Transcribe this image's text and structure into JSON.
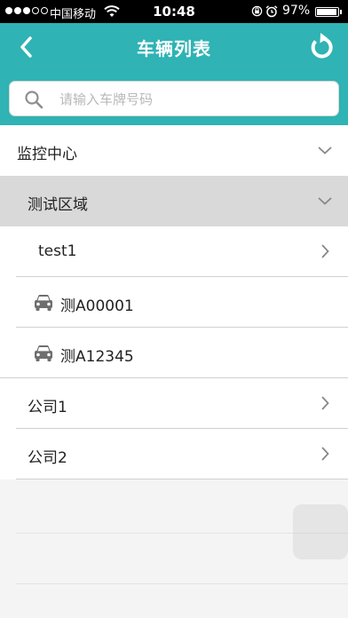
{
  "status_bar": {
    "carrier": "中国移动",
    "time": "10:48",
    "battery": "97%",
    "battery_level": 0.97,
    "signal_bars_filled": 3,
    "signal_bars_total": 5
  },
  "nav": {
    "title": "车辆列表",
    "back_icon": "chevron-left-icon",
    "refresh_icon": "refresh-icon"
  },
  "search": {
    "placeholder": "请输入车牌号码",
    "value": "",
    "icon": "search-icon"
  },
  "tree": {
    "root": {
      "label": "监控中心",
      "icon": "chevron-down-icon"
    },
    "region": {
      "label": "测试区域",
      "icon": "chevron-down-icon"
    },
    "group_test1": {
      "label": "test1",
      "icon": "chevron-right-icon"
    },
    "vehicles": [
      {
        "label": "测A00001",
        "icon": "car-icon"
      },
      {
        "label": "测A12345",
        "icon": "car-icon"
      }
    ],
    "companies": [
      {
        "label": "公司1",
        "icon": "chevron-right-icon"
      },
      {
        "label": "公司2",
        "icon": "chevron-right-icon"
      }
    ]
  },
  "colors": {
    "accent": "#2fb3b4",
    "selected_row": "#d9d9d9",
    "background": "#f4f4f4"
  }
}
